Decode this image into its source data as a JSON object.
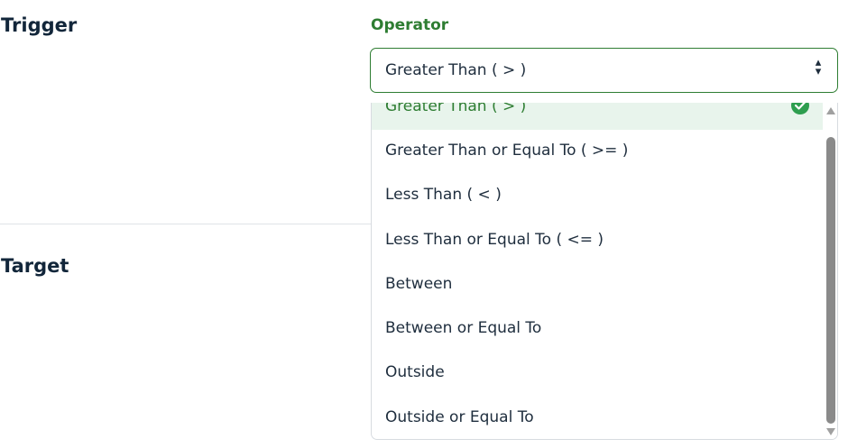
{
  "sections": {
    "trigger_title": "Trigger",
    "target_title": "Target"
  },
  "operator": {
    "label": "Operator",
    "selected_value": "Greater Than ( > )",
    "caret_up": "▴",
    "caret_down": "▾",
    "options": [
      "Greater Than ( > )",
      "Greater Than or Equal To ( >= )",
      "Less Than ( < )",
      "Less Than or Equal To ( <= )",
      "Between",
      "Between or Equal To",
      "Outside",
      "Outside or Equal To"
    ],
    "selected_icon": "check-circle-icon"
  },
  "colors": {
    "accent": "#2e7d32",
    "selected_row_bg": "#e8f4ec",
    "check_icon": "#2e9e4f",
    "heading": "#12263a"
  }
}
